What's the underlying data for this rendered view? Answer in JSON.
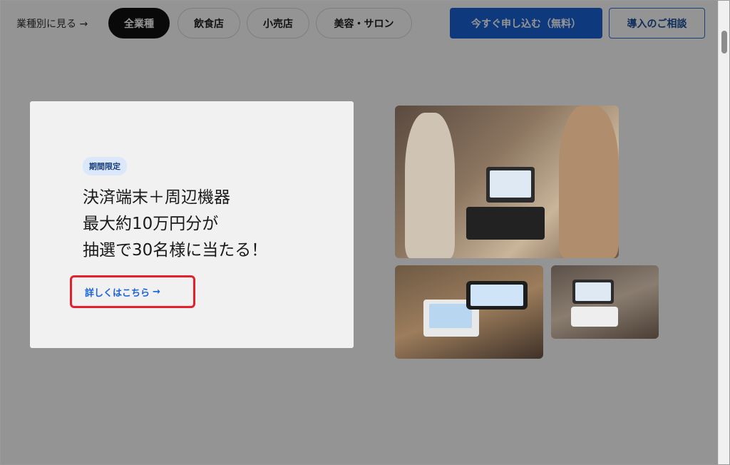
{
  "nav": {
    "label": "業種別に見る →",
    "pills": [
      {
        "label": "全業種",
        "active": true
      },
      {
        "label": "飲食店",
        "active": false
      },
      {
        "label": "小売店",
        "active": false
      },
      {
        "label": "美容・サロン",
        "active": false
      }
    ],
    "cta_primary": "今すぐ申し込む（無料）",
    "cta_secondary": "導入のご相談"
  },
  "modal": {
    "badge": "期間限定",
    "headline_lines": [
      "決済端末＋周辺機器",
      "最大約10万円分が",
      "抽選で30名様に当たる！"
    ],
    "link_label": "詳しくはこちら",
    "link_arrow": "→"
  },
  "colors": {
    "primary": "#1a63d8",
    "highlight": "#e5202a"
  }
}
